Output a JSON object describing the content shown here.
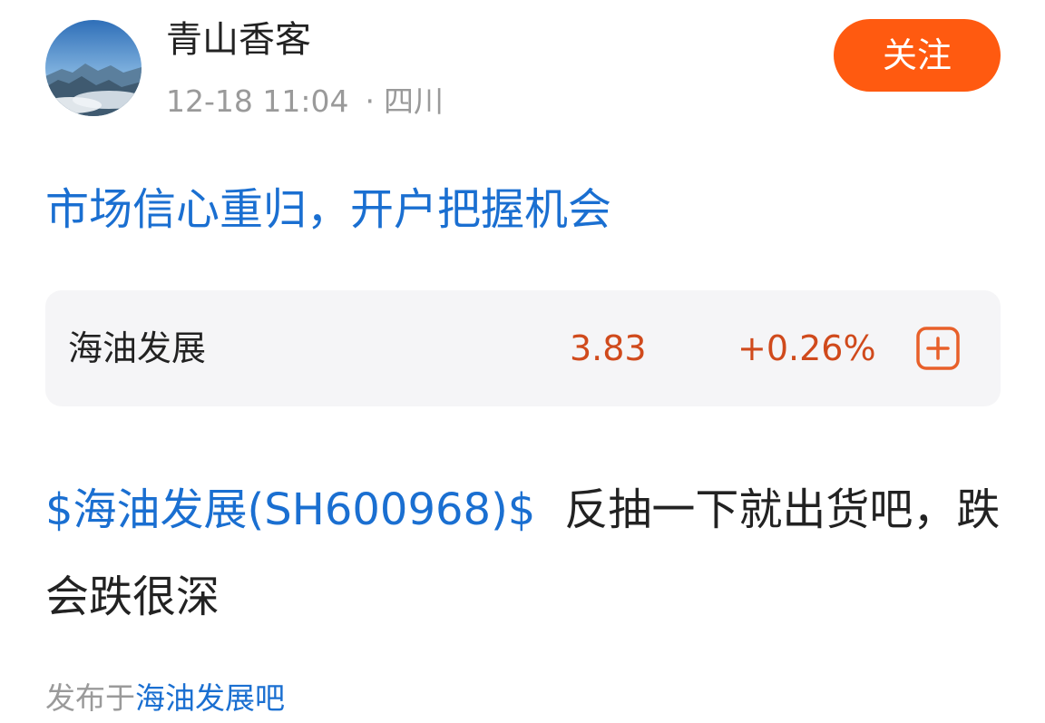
{
  "author": {
    "name": "青山香客",
    "avatar_icon": "mountain-landscape-avatar",
    "time": "12-18 11:04",
    "separator": "·",
    "location": "四川"
  },
  "follow_label": "关注",
  "post": {
    "title": "市场信心重归，开户把握机会",
    "stock_link": "$海油发展(SH600968)$",
    "text": "反抽一下就出货吧，跌会跌很深"
  },
  "stock_card": {
    "name": "海油发展",
    "price": "3.83",
    "change": "+0.26%",
    "add_icon": "plus-square-icon"
  },
  "footer": {
    "published_prefix": "发布于",
    "forum": "海油发展吧"
  },
  "colors": {
    "accent_blue": "#1a6fd1",
    "follow_orange": "#ff5a10",
    "stock_red": "#d04a1c",
    "muted_gray": "#9a9a9a",
    "card_bg": "#f5f5f7"
  }
}
